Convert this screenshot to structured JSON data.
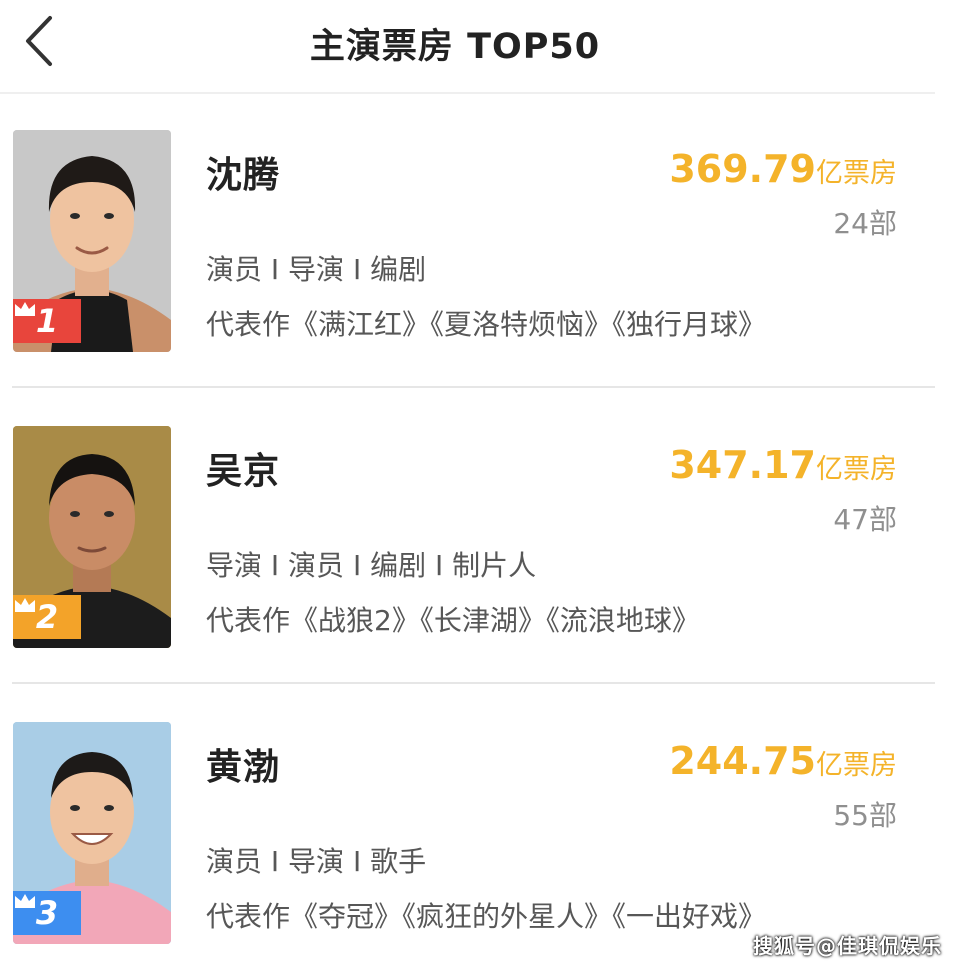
{
  "header": {
    "title": "主演票房 TOP50",
    "back_icon": "chevron-left-icon"
  },
  "actors": [
    {
      "rank": "1",
      "name": "沈腾",
      "box_office_value": "369.79",
      "box_office_unit": "亿票房",
      "film_count": "24部",
      "roles": "演员 I 导演 I 编剧",
      "works": "代表作《满江红》《夏洛特烦恼》《独行月球》",
      "badge_color": "#e8453c",
      "photo_icon": "actor-photo-icon"
    },
    {
      "rank": "2",
      "name": "吴京",
      "box_office_value": "347.17",
      "box_office_unit": "亿票房",
      "film_count": "47部",
      "roles": "导演 I 演员 I 编剧 I 制片人",
      "works": "代表作《战狼2》《长津湖》《流浪地球》",
      "badge_color": "#f3a329",
      "photo_icon": "actor-photo-icon"
    },
    {
      "rank": "3",
      "name": "黄渤",
      "box_office_value": "244.75",
      "box_office_unit": "亿票房",
      "film_count": "55部",
      "roles": "演员 I 导演 I 歌手",
      "works": "代表作《夺冠》《疯狂的外星人》《一出好戏》",
      "badge_color": "#3d8ef0",
      "photo_icon": "actor-photo-icon"
    }
  ],
  "colors": {
    "box_office": "#f4b32a",
    "divider": "#e6e6e6"
  },
  "watermark": "搜狐号@佳琪侃娱乐"
}
